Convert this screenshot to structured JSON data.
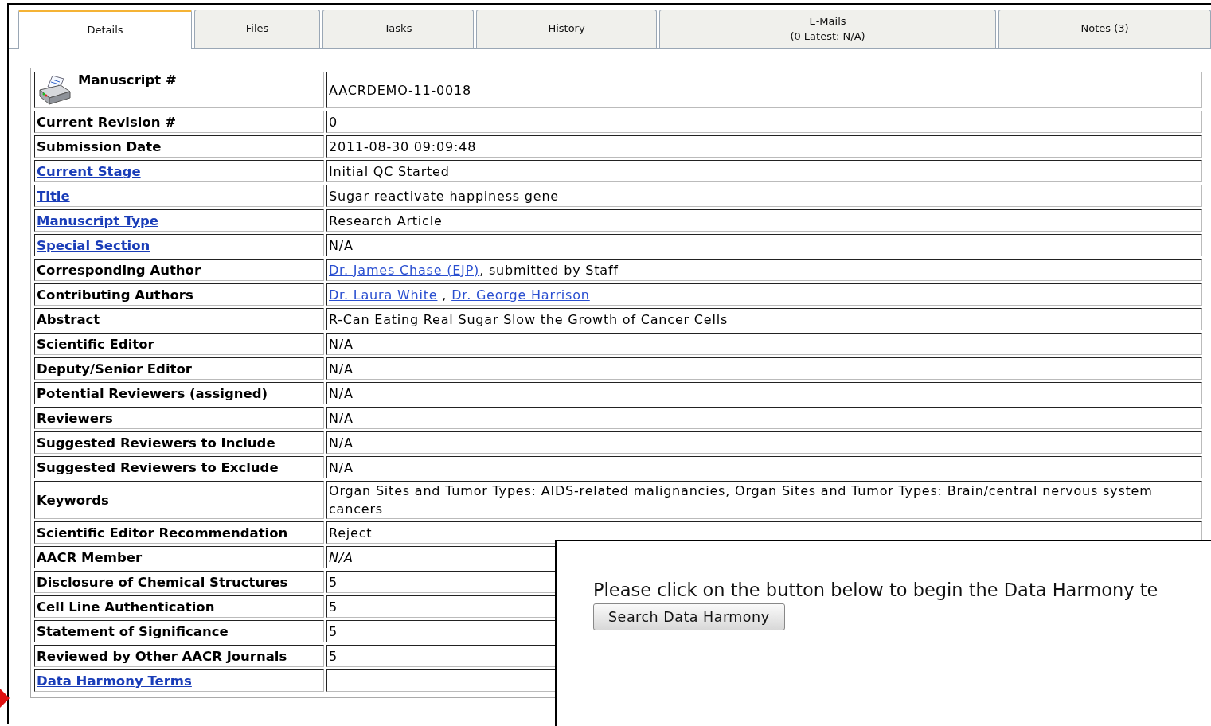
{
  "tabs": [
    {
      "label": "Details",
      "selected": true
    },
    {
      "label": "Files",
      "selected": false
    },
    {
      "label": "Tasks",
      "selected": false
    },
    {
      "label": "History",
      "selected": false
    },
    {
      "label": "E-Mails\n(0 Latest: N/A)",
      "selected": false
    },
    {
      "label": "Notes (3)",
      "selected": false
    }
  ],
  "details": {
    "rows": [
      {
        "label": "Manuscript #",
        "label_link": false,
        "has_icon": true,
        "value": [
          {
            "text": "AACRDEMO-11-0018",
            "link": false
          }
        ]
      },
      {
        "label": "Current Revision #",
        "label_link": false,
        "value": [
          {
            "text": "0",
            "link": false
          }
        ]
      },
      {
        "label": "Submission Date",
        "label_link": false,
        "value": [
          {
            "text": "2011-08-30 09:09:48",
            "link": false
          }
        ]
      },
      {
        "label": "Current Stage",
        "label_link": true,
        "value": [
          {
            "text": "Initial QC Started",
            "link": false
          }
        ]
      },
      {
        "label": "Title",
        "label_link": true,
        "value": [
          {
            "text": "Sugar reactivate happiness gene",
            "link": false
          }
        ]
      },
      {
        "label": "Manuscript Type",
        "label_link": true,
        "value": [
          {
            "text": "Research Article",
            "link": false
          }
        ]
      },
      {
        "label": "Special Section",
        "label_link": true,
        "value": [
          {
            "text": "N/A",
            "link": false
          }
        ]
      },
      {
        "label": "Corresponding Author",
        "label_link": false,
        "value": [
          {
            "text": "Dr. James Chase (EJP)",
            "link": true
          },
          {
            "text": ", submitted by Staff",
            "link": false
          }
        ]
      },
      {
        "label": "Contributing Authors",
        "label_link": false,
        "value": [
          {
            "text": "Dr. Laura White",
            "link": true
          },
          {
            "text": " , ",
            "link": false
          },
          {
            "text": "Dr. George Harrison",
            "link": true
          }
        ]
      },
      {
        "label": "Abstract",
        "label_link": false,
        "value": [
          {
            "text": "R-Can Eating Real Sugar Slow the Growth of Cancer Cells",
            "link": false
          }
        ]
      },
      {
        "label": "Scientific Editor",
        "label_link": false,
        "value": [
          {
            "text": "N/A",
            "link": false
          }
        ]
      },
      {
        "label": "Deputy/Senior Editor",
        "label_link": false,
        "value": [
          {
            "text": "N/A",
            "link": false
          }
        ]
      },
      {
        "label": "Potential Reviewers (assigned)",
        "label_link": false,
        "value": [
          {
            "text": "N/A",
            "link": false
          }
        ]
      },
      {
        "label": "Reviewers",
        "label_link": false,
        "value": [
          {
            "text": "N/A",
            "link": false
          }
        ]
      },
      {
        "label": "Suggested Reviewers to Include",
        "label_link": false,
        "value": [
          {
            "text": "N/A",
            "link": false
          }
        ]
      },
      {
        "label": "Suggested Reviewers to Exclude",
        "label_link": false,
        "value": [
          {
            "text": "N/A",
            "link": false
          }
        ]
      },
      {
        "label": "Keywords",
        "label_link": false,
        "value": [
          {
            "text": "Organ Sites and Tumor Types: AIDS-related malignancies, Organ Sites and Tumor Types: Brain/central nervous system cancers",
            "link": false
          }
        ]
      },
      {
        "label": "Scientific Editor Recommendation",
        "label_link": false,
        "value": [
          {
            "text": "Reject",
            "link": false
          }
        ]
      },
      {
        "label": "AACR Member",
        "label_link": false,
        "italic": true,
        "value": [
          {
            "text": "N/A",
            "link": false
          }
        ]
      },
      {
        "label": "Disclosure of Chemical Structures",
        "label_link": false,
        "value": [
          {
            "text": "5",
            "link": false
          }
        ]
      },
      {
        "label": "Cell Line Authentication",
        "label_link": false,
        "value": [
          {
            "text": "5",
            "link": false
          }
        ]
      },
      {
        "label": "Statement of Significance",
        "label_link": false,
        "value": [
          {
            "text": "5",
            "link": false
          }
        ]
      },
      {
        "label": "Reviewed by Other AACR Journals",
        "label_link": false,
        "value": [
          {
            "text": "5",
            "link": false
          }
        ]
      },
      {
        "label": "Data Harmony Terms",
        "label_link": true,
        "value": []
      }
    ]
  },
  "popup": {
    "message": "Please click on the button below to begin the Data Harmony te",
    "button": "Search Data Harmony"
  }
}
